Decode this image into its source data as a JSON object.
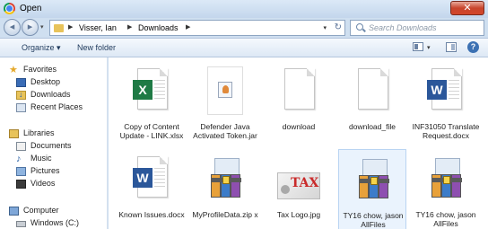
{
  "window": {
    "title": "Open",
    "close_label": "✕"
  },
  "address": {
    "crumbs": [
      "Visser, Ian",
      "Downloads"
    ],
    "search_placeholder": "Search Downloads",
    "refresh_glyph": "↻"
  },
  "toolbar": {
    "organize_label": "Organize ▾",
    "new_folder_label": "New folder",
    "help_label": "?"
  },
  "nav": {
    "favorites_label": "Favorites",
    "desktop_label": "Desktop",
    "downloads_label": "Downloads",
    "recent_label": "Recent Places",
    "libraries_label": "Libraries",
    "documents_label": "Documents",
    "music_label": "Music",
    "pictures_label": "Pictures",
    "videos_label": "Videos",
    "computer_label": "Computer",
    "drive_label": "Windows (C:)"
  },
  "files": [
    {
      "name": "Copy of Content Update - LINK.xlsx",
      "type": "excel",
      "selected": false
    },
    {
      "name": "Defender Java Activated Token.jar",
      "type": "jar",
      "selected": false
    },
    {
      "name": "download",
      "type": "blank",
      "selected": false
    },
    {
      "name": "download_file",
      "type": "blank",
      "selected": false
    },
    {
      "name": "INF31050 Translate Request.docx",
      "type": "word",
      "selected": false
    },
    {
      "name": "Known Issues.docx",
      "type": "word",
      "selected": false
    },
    {
      "name": "MyProfileData.zip x",
      "type": "zip",
      "selected": false
    },
    {
      "name": "Tax Logo.jpg",
      "type": "image",
      "selected": false
    },
    {
      "name": "TY16 chow, jason AllFiles",
      "type": "zip",
      "selected": true
    },
    {
      "name": "TY16 chow, jason AllFiles",
      "type": "zip",
      "selected": false
    }
  ],
  "icon_text": {
    "excel": "X",
    "word": "W",
    "tax": "TAX"
  },
  "colors": {
    "excel": "#1f7a45",
    "word": "#2b579a",
    "close": "#c8452c",
    "selection": "#eaf3fd"
  }
}
